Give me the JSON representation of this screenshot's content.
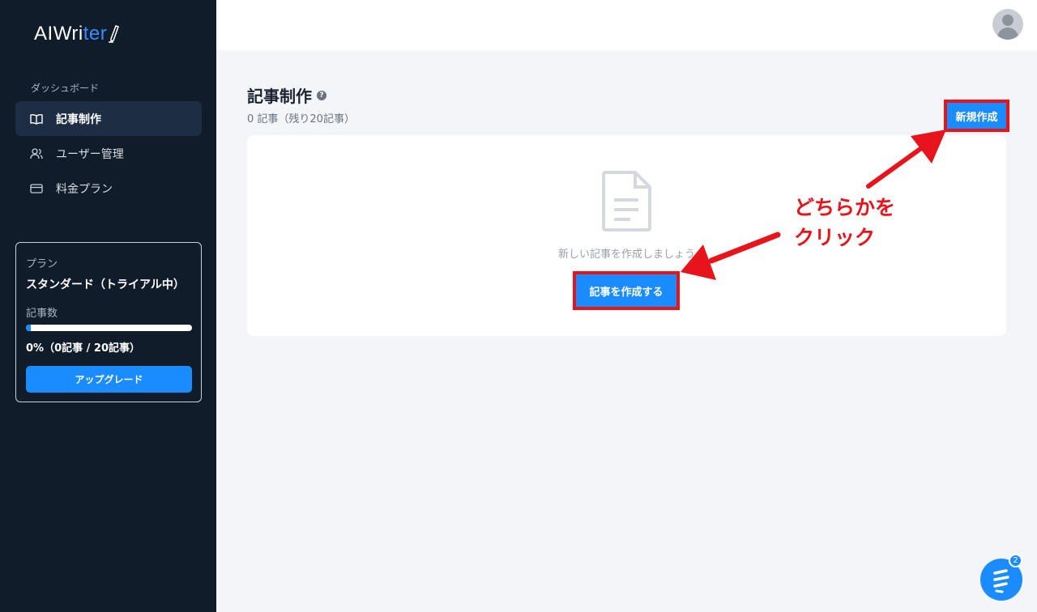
{
  "sidebar": {
    "logo_ai": "AI ",
    "logo_wri": "Wri",
    "logo_ter": "ter",
    "section_label": "ダッシュボード",
    "items": [
      {
        "label": "記事制作",
        "icon": "book-icon",
        "active": true
      },
      {
        "label": "ユーザー管理",
        "icon": "users-icon",
        "active": false
      },
      {
        "label": "料金プラン",
        "icon": "credit-card-icon",
        "active": false
      }
    ],
    "plan": {
      "label": "プラン",
      "name": "スタンダード（トライアル中）",
      "count_label": "記事数",
      "progress_fraction": 0.03,
      "count_text": "0%（0記事 / 20記事）",
      "upgrade_label": "アップグレード"
    }
  },
  "main": {
    "title": "記事制作",
    "help_glyph": "?",
    "subtitle": "0 記事（残り20記事）",
    "new_button": "新規作成",
    "empty_text": "新しい記事を作成しましょう",
    "create_button": "記事を作成する"
  },
  "annotation": {
    "line1": "どちらかを",
    "line2": "クリック"
  },
  "chat": {
    "badge": "2"
  },
  "colors": {
    "accent": "#1a8cff",
    "sidebar_bg": "#111c2b",
    "highlight_red": "#e8141b"
  }
}
